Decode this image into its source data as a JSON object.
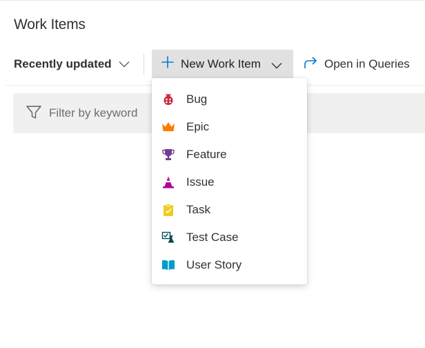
{
  "header": {
    "title": "Work Items"
  },
  "toolbar": {
    "sort_label": "Recently updated",
    "new_item_label": "New Work Item",
    "queries_label": "Open in Queries"
  },
  "filter": {
    "placeholder": "Filter by keyword"
  },
  "menu": {
    "items": [
      {
        "label": "Bug",
        "icon": "bug-icon",
        "color": "#cc293d"
      },
      {
        "label": "Epic",
        "icon": "crown-icon",
        "color": "#ff7b00"
      },
      {
        "label": "Feature",
        "icon": "trophy-icon",
        "color": "#773b93"
      },
      {
        "label": "Issue",
        "icon": "cone-icon",
        "color": "#b4009e"
      },
      {
        "label": "Task",
        "icon": "clipboard-icon",
        "color": "#f2cb1d"
      },
      {
        "label": "Test Case",
        "icon": "test-case-icon",
        "color": "#004b50"
      },
      {
        "label": "User Story",
        "icon": "book-icon",
        "color": "#009ccc"
      }
    ]
  },
  "colors": {
    "accent": "#0078d4",
    "button_bg": "#e1e1e1",
    "filter_bg": "#f0f0f0"
  }
}
